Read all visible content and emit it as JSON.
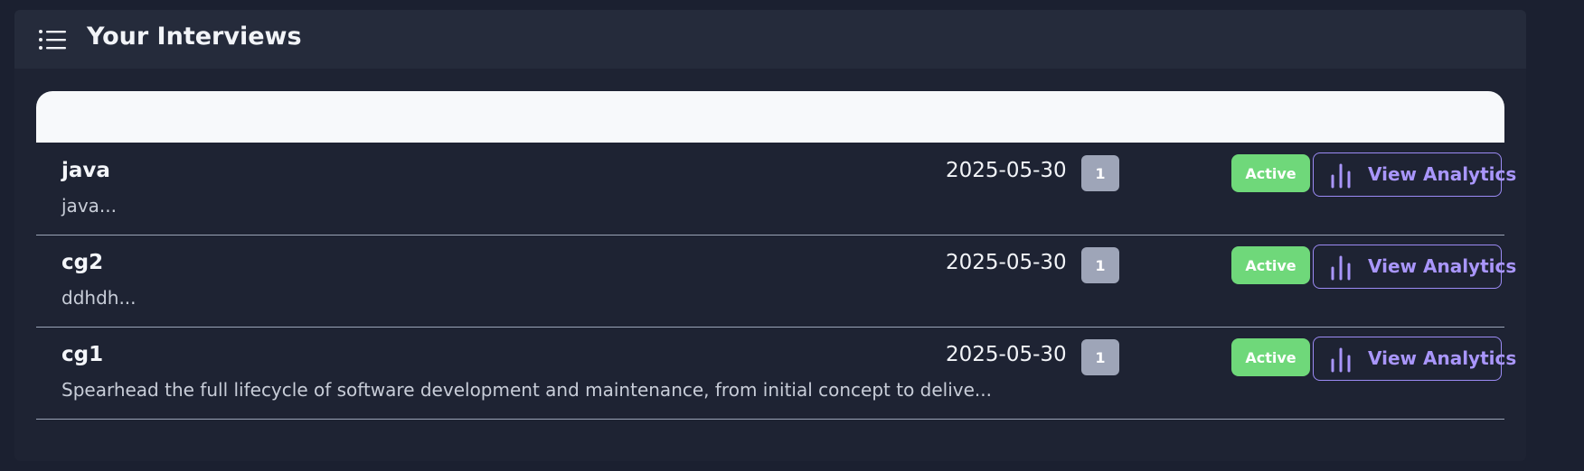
{
  "header": {
    "title": "Your Interviews",
    "icon": "list-icon"
  },
  "table": {
    "columns": [
      "",
      "",
      "",
      "",
      ""
    ],
    "rows": [
      {
        "title": "java",
        "description": "java...",
        "date": "2025-05-30",
        "questions": "1",
        "status": "Active",
        "action_label": "View Analytics"
      },
      {
        "title": "cg2",
        "description": "ddhdh...",
        "date": "2025-05-30",
        "questions": "1",
        "status": "Active",
        "action_label": "View Analytics"
      },
      {
        "title": "cg1",
        "description": "Spearhead the full lifecycle of software development and maintenance, from initial concept to delive...",
        "date": "2025-05-30",
        "questions": "1",
        "status": "Active",
        "action_label": "View Analytics"
      }
    ]
  },
  "colors": {
    "page_bg": "#1b2030",
    "card_bg": "#1e2333",
    "header_bg": "#252b3b",
    "status_active": "#6fd87a",
    "question_badge": "#9ea5b8",
    "accent": "#a996fb"
  }
}
